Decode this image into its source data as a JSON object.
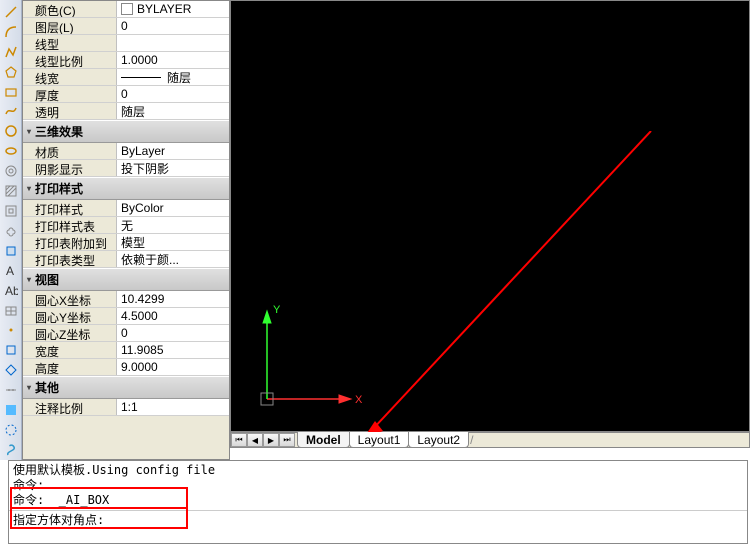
{
  "toolbar": {
    "icons": [
      "line",
      "arc",
      "rect",
      "polyline",
      "spline",
      "circle",
      "ellipse",
      "poly",
      "hatch",
      "point",
      "text",
      "dim",
      "blue-swirl",
      "refresh"
    ]
  },
  "props": {
    "sections": [
      {
        "title": "",
        "rows": [
          {
            "label": "颜色(C)",
            "value": "BYLAYER",
            "checkbox": true
          },
          {
            "label": "图层(L)",
            "value": "0"
          },
          {
            "label": "线型",
            "value": ""
          },
          {
            "label": "线型比例",
            "value": "1.0000"
          },
          {
            "label": "线宽",
            "value": "随层",
            "lineweight": true
          },
          {
            "label": "厚度",
            "value": "0"
          },
          {
            "label": "透明",
            "value": "随层"
          }
        ]
      },
      {
        "title": "三维效果",
        "rows": [
          {
            "label": "材质",
            "value": "ByLayer"
          },
          {
            "label": "阴影显示",
            "value": "投下阴影"
          }
        ]
      },
      {
        "title": "打印样式",
        "rows": [
          {
            "label": "打印样式",
            "value": "ByColor"
          },
          {
            "label": "打印样式表",
            "value": "无"
          },
          {
            "label": "打印表附加到",
            "value": "模型"
          },
          {
            "label": "打印表类型",
            "value": "依赖于颜..."
          }
        ]
      },
      {
        "title": "视图",
        "rows": [
          {
            "label": "圆心X坐标",
            "value": "10.4299"
          },
          {
            "label": "圆心Y坐标",
            "value": "4.5000"
          },
          {
            "label": "圆心Z坐标",
            "value": "0"
          },
          {
            "label": "宽度",
            "value": "11.9085"
          },
          {
            "label": "高度",
            "value": "9.0000"
          }
        ]
      },
      {
        "title": "其他",
        "rows": [
          {
            "label": "注释比例",
            "value": "1:1"
          }
        ]
      }
    ]
  },
  "ucs": {
    "x_label": "X",
    "y_label": "Y"
  },
  "tabs": {
    "items": [
      "Model",
      "Layout1",
      "Layout2"
    ],
    "active": 0
  },
  "cmd": {
    "history_lines": [
      "使用默认模板.Using config file",
      "命令:",
      "命令:  _AI_BOX"
    ],
    "prompt": "指定方体对角点:",
    "input_value": ""
  }
}
